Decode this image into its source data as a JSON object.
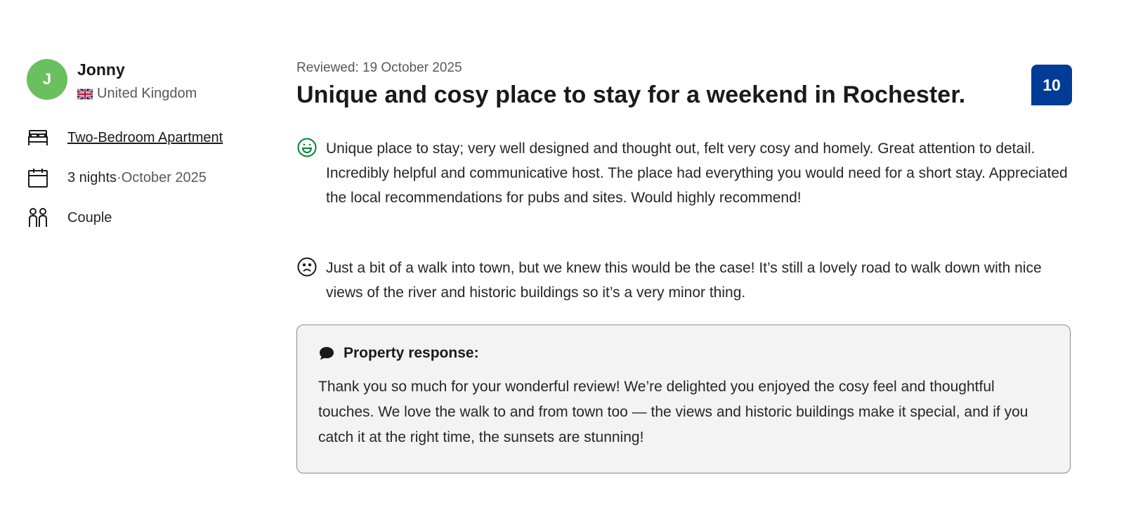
{
  "reviewer": {
    "initial": "J",
    "name": "Jonny",
    "country": "United Kingdom",
    "flag_icon": "uk-flag-icon",
    "avatar_color": "#6abf5e"
  },
  "stay": {
    "room_type": "Two-Bedroom Apartment",
    "nights": "3 nights",
    "separator": " · ",
    "month": "October 2025",
    "traveller_type": "Couple",
    "icons": [
      "bed-icon",
      "calendar-icon",
      "couple-icon"
    ]
  },
  "review": {
    "reviewed_label": "Reviewed: 19 October 2025",
    "title": "Unique and cosy place to stay for a weekend in Rochester.",
    "score": "10",
    "score_color": "#003b95",
    "positive_icon": "smiley-face-icon",
    "positive_color": "#008234",
    "positive": "Unique place to stay; very well designed and thought out, felt very cosy and homely. Great attention to detail. Incredibly helpful and communicative host. The place had everything you would need for a short stay. Appreciated the local recommendations for pubs and sites. Would highly recommend!",
    "negative_icon": "sad-face-icon",
    "negative": "Just a bit of a walk into town, but we knew this would be the case! It’s still a lovely road to walk down with nice views of the river and historic buildings so it’s a very minor thing."
  },
  "property_response": {
    "icon": "speech-bubble-icon",
    "heading": "Property response:",
    "text": "Thank you so much for your wonderful review! We’re delighted you enjoyed the cosy feel and thoughtful touches. We love the walk to and from town too — the views and historic buildings make it special, and if you catch it at the right time, the sunsets are stunning!"
  }
}
